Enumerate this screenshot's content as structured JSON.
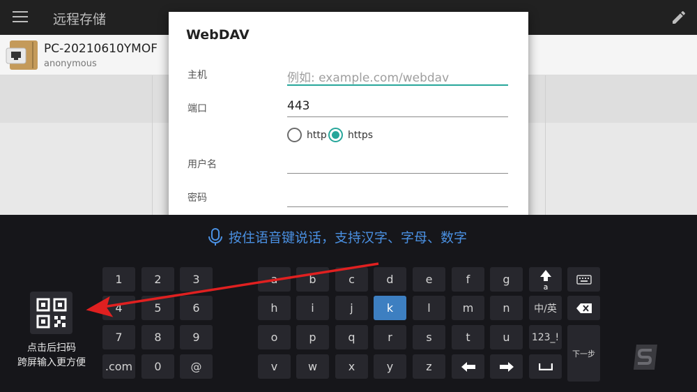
{
  "appbar": {
    "title": "远程存储",
    "menu_icon": "hamburger-menu-icon",
    "edit_icon": "pencil-icon"
  },
  "server": {
    "name": "PC-20210610YMOF",
    "user": "anonymous",
    "icon": "computer-folder-icon"
  },
  "dialog": {
    "title": "WebDAV",
    "host_label": "主机",
    "host_placeholder": "例如: example.com/webdav",
    "host_value": "",
    "port_label": "端口",
    "port_value": "443",
    "protocol_options": [
      {
        "label": "http",
        "selected": false
      },
      {
        "label": "https",
        "selected": true
      }
    ],
    "username_label": "用户名",
    "username_value": "",
    "password_label": "密码",
    "password_value": ""
  },
  "keyboard": {
    "voice_hint": "按住语音键说话，支持汉字、字母、数字",
    "numpad": [
      "1",
      "2",
      "3",
      "4",
      "5",
      "6",
      "7",
      "8",
      "9",
      ".com",
      "0",
      "@"
    ],
    "letters_row1": [
      "a",
      "b",
      "c",
      "d",
      "e",
      "f",
      "g"
    ],
    "letters_row2": [
      "h",
      "i",
      "j",
      "k",
      "l",
      "m",
      "n"
    ],
    "letters_row3": [
      "o",
      "p",
      "q",
      "r",
      "s",
      "t",
      "u"
    ],
    "letters_row4": [
      "v",
      "w",
      "x",
      "y",
      "z"
    ],
    "active_key": "k",
    "lang_switch": "中/英",
    "symbols_key": "123_!",
    "next_key": "下一步",
    "qr_caption_line1": "点击后扫码",
    "qr_caption_line2": "跨屏输入更方便"
  },
  "colors": {
    "accent": "#26a69a",
    "keyboard_bg": "#16161a",
    "key_bg": "#27272d",
    "active_key": "#3d7fc1",
    "voice_hint": "#4a90e2",
    "arrow": "#e02020"
  }
}
